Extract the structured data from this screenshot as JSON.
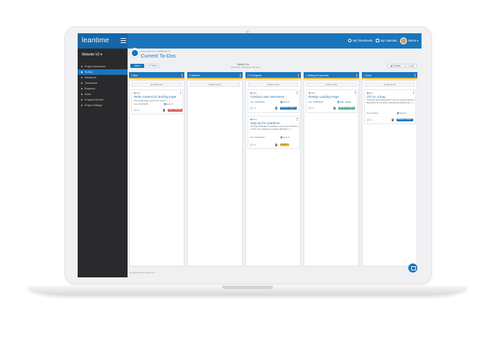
{
  "app": {
    "logo": "leantime",
    "nav_links": [
      "My Timesheets",
      "My Calendar"
    ],
    "user_menu": "Demo"
  },
  "sidebar": {
    "project": "Website V2",
    "items": [
      {
        "label": "Project Dashboard",
        "active": false
      },
      {
        "label": "To-Dos",
        "active": true
      },
      {
        "label": "Milestones",
        "active": false
      },
      {
        "label": "Timesheets",
        "active": false
      },
      {
        "label": "Research",
        "active": false
      },
      {
        "label": "Ideas",
        "active": false
      },
      {
        "label": "Progress Review",
        "active": false
      },
      {
        "label": "Project Settings",
        "active": false
      }
    ]
  },
  "header": {
    "breadcrumb": "LEANTIME LTD // WEBSITE V2",
    "title": "Current To-Dos"
  },
  "toolbar": {
    "add_label": "Add",
    "filter_label": "Filters",
    "sprint_label": "Sprint 3",
    "sprint_dates": "05/14/2019 - 06/21/2019 · Edit Sprint",
    "kanban_label": "Kanban",
    "list_label": "List"
  },
  "columns": [
    {
      "header": "1 New",
      "add_label": "Add To-Do",
      "cards": [
        {
          "type": "Task",
          "title": "Write content for landing page",
          "desc": "The landing page needs new content. (...)",
          "due_label": "Due:",
          "due": "03/27/2019",
          "user": "Demo",
          "foot": "1  1",
          "badge": "1",
          "status": "FIRST TIME DEV",
          "status_color": "#d9534f"
        }
      ]
    },
    {
      "header": "0 Blocked",
      "add_label": "Add To-Do",
      "cards": []
    },
    {
      "header": "2 In Progress",
      "add_label": "Add To-Do",
      "cards": [
        {
          "type": "Task",
          "title": "Conduct user interviews",
          "desc": "",
          "due_label": "Due:",
          "due": "03/30/2019",
          "user": "Demo",
          "foot": "1  1",
          "badge": "1",
          "status": "PROJECT STAGE 1",
          "status_color": "#1b75bb"
        },
        {
          "type": "Story",
          "title": "Sign-up for Leantime",
          "desc": "As Project Manager I would like to sign up for Leantime so that I can manage my projects effectively (...)",
          "due_label": "Due:",
          "due": "03/11/2019",
          "user": "Demo",
          "foot": "1  1",
          "badge": "0",
          "status": "MONTH 1",
          "status_color": "#f0c03c"
        }
      ]
    },
    {
      "header": "1 Waiting for Approval",
      "add_label": "Add To-Do",
      "cards": [
        {
          "type": "Task",
          "title": "Design Landing Page",
          "desc": "",
          "due_label": "Due:",
          "due": "03/28/2019",
          "user": "Clark, Clark",
          "foot": "1  1",
          "badge": "0",
          "status": "PROJECT STAGE 1",
          "status_color": "#4caf8a"
        }
      ]
    },
    {
      "header": "1 Done",
      "add_label": "Add To-Do",
      "cards": [
        {
          "type": "Bug",
          "title": "Oh no, a bug",
          "desc": "Summary:Something doesn't work as expected.Steps to Reproduce:Prio is what it is.Expected Results:true (...)",
          "due_label": "Due:",
          "due": "Anytime",
          "user": "Demo",
          "foot": "1  1",
          "badge": "1",
          "status": "PROJECT STAGE 1",
          "status_color": "#1b75bb"
        }
      ]
    }
  ],
  "footer": {
    "copyright": "Copyright Leantime Systems Inc."
  },
  "colors": {
    "brand": "#1b75bb",
    "sidebar": "#2a2a2c",
    "column_accent": "#f0b43c"
  }
}
